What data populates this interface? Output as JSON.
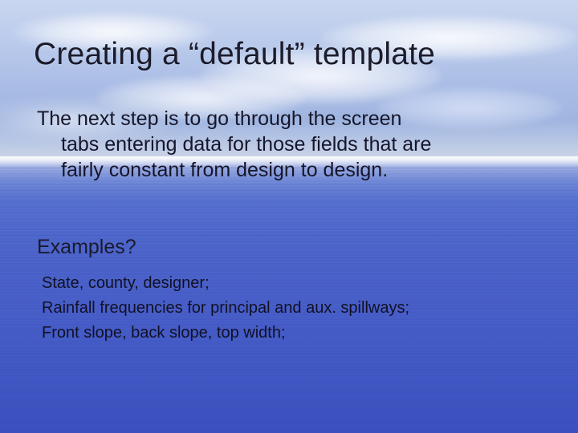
{
  "title": "Creating a “default” template",
  "body": {
    "line1": "The next step is to go through the screen",
    "line2": "tabs entering data for those fields that are",
    "line3": "fairly constant from design to design."
  },
  "subheading": "Examples?",
  "examples": [
    "State, county, designer;",
    "Rainfall frequencies for principal and aux. spillways;",
    "Front slope, back slope, top width;"
  ]
}
